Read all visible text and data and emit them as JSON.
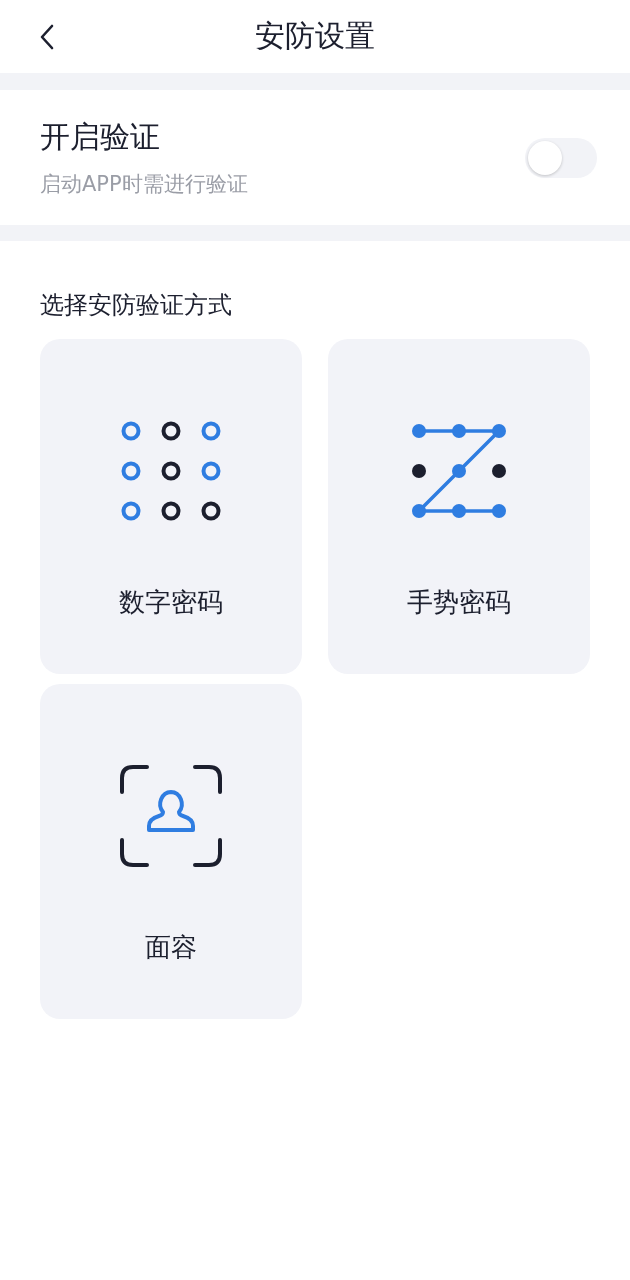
{
  "header": {
    "title": "安防设置"
  },
  "verification": {
    "title": "开启验证",
    "subtitle": "启动APP时需进行验证",
    "on": false
  },
  "methods": {
    "heading": "选择安防验证方式",
    "items": [
      {
        "kind": "digits",
        "label": "数字密码"
      },
      {
        "kind": "gesture",
        "label": "手势密码"
      },
      {
        "kind": "face",
        "label": "面容"
      }
    ]
  }
}
